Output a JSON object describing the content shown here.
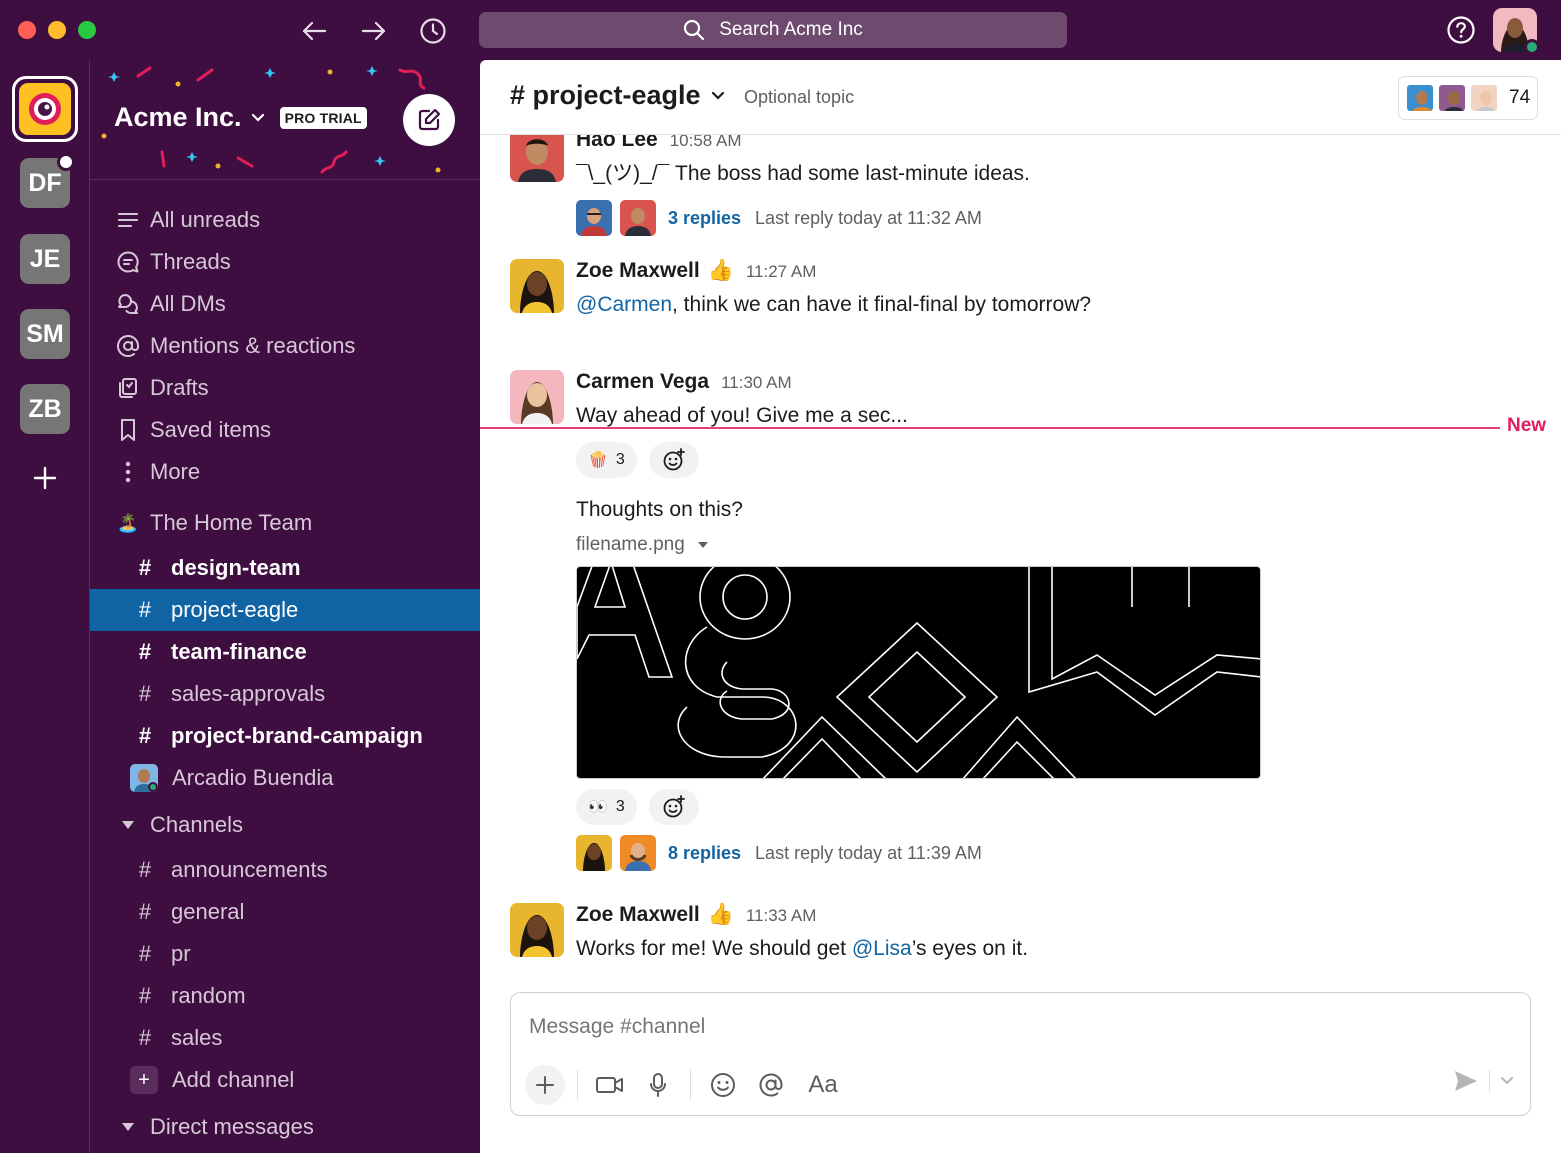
{
  "search": {
    "label": "Search Acme Inc"
  },
  "workspaces": [
    "DF",
    "JE",
    "SM",
    "ZB"
  ],
  "workspace": {
    "name": "Acme Inc.",
    "badge": "PRO TRIAL"
  },
  "nav": {
    "all_unreads": "All unreads",
    "threads": "Threads",
    "all_dms": "All DMs",
    "mentions": "Mentions & reactions",
    "drafts": "Drafts",
    "saved": "Saved items",
    "more": "More"
  },
  "team_section": {
    "emoji": "🏝️",
    "label": "The Home Team"
  },
  "team_channels": [
    {
      "hash": "#",
      "name": "design-team"
    },
    {
      "hash": "#",
      "name": "project-eagle"
    },
    {
      "hash": "#",
      "name": "team-finance"
    },
    {
      "hash": "#",
      "name": "sales-approvals"
    },
    {
      "hash": "#",
      "name": "project-brand-campaign"
    }
  ],
  "team_dm": {
    "name": "Arcadio Buendia"
  },
  "channels_section": {
    "label": "Channels"
  },
  "channels": [
    {
      "hash": "#",
      "name": "announcements"
    },
    {
      "hash": "#",
      "name": "general"
    },
    {
      "hash": "#",
      "name": "pr"
    },
    {
      "hash": "#",
      "name": "random"
    },
    {
      "hash": "#",
      "name": "sales"
    }
  ],
  "add_channel": {
    "plus": "+",
    "label": "Add channel"
  },
  "dm_section": {
    "label": "Direct messages"
  },
  "channel": {
    "name": "# project-eagle",
    "topic": "Optional topic",
    "member_count": "74"
  },
  "messages": [
    {
      "author": "Hao Lee",
      "time": "10:58 AM",
      "text": "¯\\_(ツ)_/¯ The boss had some last-minute ideas.",
      "replies": "3 replies",
      "last_reply": "Last reply today at 11:32 AM"
    },
    {
      "author": "Zoe Maxwell",
      "status_emoji": "👍",
      "time": "11:27 AM",
      "mention": "@Carmen",
      "text": ", think we can have it final-final by tomorrow?"
    },
    {
      "author": "Carmen Vega",
      "time": "11:30 AM",
      "text": "Way ahead of you! Give me a sec...",
      "reaction": {
        "emoji": "🍿",
        "count": "3"
      },
      "followup": "Thoughts on this?",
      "file": "filename.png",
      "file_reaction": {
        "emoji": "👀",
        "count": "3"
      },
      "replies": "8 replies",
      "last_reply": "Last reply today at 11:39 AM"
    },
    {
      "author": "Zoe Maxwell",
      "status_emoji": "👍",
      "time": "11:33 AM",
      "text_before": "Works for me! We should get ",
      "mention": "@Lisa",
      "text_after": "’s eyes on it."
    }
  ],
  "new_divider": "New",
  "composer": {
    "placeholder": "Message #channel",
    "format_label": "Aa"
  },
  "colors": {
    "aubergine": "#3f0e40",
    "active_channel": "#1164a3",
    "mention": "#1264a3",
    "new_line": "#e01e5a",
    "presence": "#2bac76"
  }
}
